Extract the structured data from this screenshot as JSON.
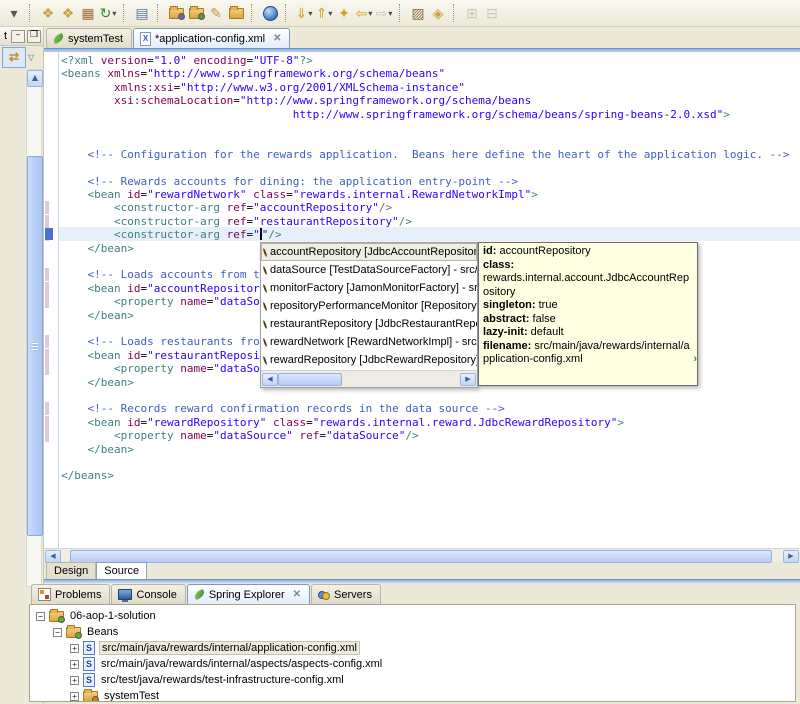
{
  "colors": {
    "accent_blue": "#6F94C4",
    "selection_line": "#E6F0FB",
    "tooltip_bg": "#FFFFE1",
    "tag": "#3F7F7F",
    "attr": "#7F0055",
    "value": "#2A00FF",
    "comment": "#3F5FBF"
  },
  "toolbar": {
    "groups": [
      [
        {
          "name": "toolbar-dropdown-icon",
          "glyph": "▾",
          "color": "#555555"
        }
      ],
      [
        {
          "name": "new-spring-project-icon",
          "glyph": "❖",
          "color": "#C8A23C"
        },
        {
          "name": "new-spring-project-alt-icon",
          "glyph": "❖",
          "color": "#C8A23C"
        },
        {
          "name": "new-java-package-icon",
          "glyph": "▦",
          "color": "#A5683B"
        },
        {
          "name": "refresh-icon",
          "glyph": "↻",
          "color": "#2E8B2E",
          "caret": true
        }
      ],
      [
        {
          "name": "new-file-icon",
          "glyph": "▤",
          "color": "#5B7AA6"
        }
      ],
      [
        {
          "name": "open-import-folder-icon",
          "glyph": "folder",
          "dot": "#7B5EA7"
        },
        {
          "name": "open-export-folder-icon",
          "glyph": "folder",
          "dot": "#4E9A4E"
        },
        {
          "name": "edit-pencil-icon",
          "glyph": "✎",
          "color": "#C89234"
        },
        {
          "name": "open-folder-icon",
          "glyph": "folder"
        }
      ],
      [
        {
          "name": "web-browser-icon",
          "glyph": "globe"
        }
      ],
      [
        {
          "name": "import-arrow-icon",
          "glyph": "⇓",
          "color": "#D8A019",
          "caret": true
        },
        {
          "name": "export-arrow-icon",
          "glyph": "⇑",
          "color": "#D8A019",
          "caret": true
        },
        {
          "name": "last-edit-location-icon",
          "glyph": "✦",
          "color": "#D8A019"
        },
        {
          "name": "back-icon",
          "glyph": "⇦",
          "color": "#D8A019",
          "caret": true
        },
        {
          "name": "forward-icon",
          "glyph": "⇨",
          "color": "#9C9884",
          "disabled": true,
          "caret": true
        }
      ],
      [
        {
          "name": "mark-occurrences-icon",
          "glyph": "▨",
          "color": "#8A6B3F"
        },
        {
          "name": "annotation-icon",
          "glyph": "◈",
          "color": "#C8A23C"
        }
      ],
      [
        {
          "name": "expand-all-icon",
          "glyph": "⊞",
          "color": "#9C9884",
          "disabled": true
        },
        {
          "name": "collapse-all-icon",
          "glyph": "⊟",
          "color": "#9C9884",
          "disabled": true
        }
      ]
    ]
  },
  "left_rail": {
    "header_label": "t"
  },
  "editor": {
    "tabs": [
      {
        "label": "systemTest",
        "icon": "leaf",
        "active": false
      },
      {
        "label": "*application-config.xml",
        "icon": "xmldoc",
        "active": true,
        "close": true
      }
    ],
    "current_line": 14,
    "change_bars": [
      12,
      13,
      14,
      17,
      18,
      19,
      22,
      23,
      24,
      27,
      28,
      29
    ],
    "lines": [
      [
        [
          "<?xml ",
          "tag"
        ],
        [
          "version",
          "attr"
        ],
        [
          "=",
          "plain"
        ],
        [
          "\"1.0\"",
          "val"
        ],
        [
          " ",
          "plain"
        ],
        [
          "encoding",
          "attr"
        ],
        [
          "=",
          "plain"
        ],
        [
          "\"UTF-8\"",
          "val"
        ],
        [
          "?>",
          "tag"
        ]
      ],
      [
        [
          "<beans ",
          "tag"
        ],
        [
          "xmlns",
          "attr"
        ],
        [
          "=",
          "plain"
        ],
        [
          "\"http://www.springframework.org/schema/beans\"",
          "val"
        ]
      ],
      [
        [
          "        ",
          "plain"
        ],
        [
          "xmlns:xsi",
          "attr"
        ],
        [
          "=",
          "plain"
        ],
        [
          "\"http://www.w3.org/2001/XMLSchema-instance\"",
          "val"
        ]
      ],
      [
        [
          "        ",
          "plain"
        ],
        [
          "xsi:schemaLocation",
          "attr"
        ],
        [
          "=",
          "plain"
        ],
        [
          "\"http://www.springframework.org/schema/beans",
          "val"
        ]
      ],
      [
        [
          "                                   ",
          "plain"
        ],
        [
          "http://www.springframework.org/schema/beans/spring-beans-2.0.xsd\"",
          "val"
        ],
        [
          ">",
          "tag"
        ]
      ],
      [],
      [],
      [
        [
          "    ",
          "plain"
        ],
        [
          "<!-- Configuration for the rewards application.  Beans here define the heart of the application logic. -->",
          "comment"
        ]
      ],
      [],
      [
        [
          "    ",
          "plain"
        ],
        [
          "<!-- Rewards accounts for dining: the application entry-point -->",
          "comment"
        ]
      ],
      [
        [
          "    ",
          "plain"
        ],
        [
          "<bean ",
          "tag"
        ],
        [
          "id",
          "attr"
        ],
        [
          "=",
          "plain"
        ],
        [
          "\"rewardNetwork\"",
          "val"
        ],
        [
          " ",
          "plain"
        ],
        [
          "class",
          "attr"
        ],
        [
          "=",
          "plain"
        ],
        [
          "\"rewards.internal.RewardNetworkImpl\"",
          "val"
        ],
        [
          ">",
          "tag"
        ]
      ],
      [
        [
          "        ",
          "plain"
        ],
        [
          "<constructor-arg ",
          "tag"
        ],
        [
          "ref",
          "attr"
        ],
        [
          "=",
          "plain"
        ],
        [
          "\"accountRepository\"",
          "val"
        ],
        [
          "/>",
          "tag"
        ]
      ],
      [
        [
          "        ",
          "plain"
        ],
        [
          "<constructor-arg ",
          "tag"
        ],
        [
          "ref",
          "attr"
        ],
        [
          "=",
          "plain"
        ],
        [
          "\"restaurantRepository\"",
          "val"
        ],
        [
          "/>",
          "tag"
        ]
      ],
      [
        [
          "        ",
          "plain"
        ],
        [
          "<constructor-arg ",
          "tag"
        ],
        [
          "ref",
          "attr"
        ],
        [
          "=",
          "plain"
        ],
        [
          "\"",
          "val"
        ],
        [
          "",
          "caret"
        ],
        [
          "\"",
          "val"
        ],
        [
          "/>",
          "tag"
        ]
      ],
      [
        [
          "    ",
          "plain"
        ],
        [
          "</bean>",
          "tag"
        ]
      ],
      [],
      [
        [
          "    ",
          "plain"
        ],
        [
          "<!-- Loads accounts from t",
          "comment"
        ]
      ],
      [
        [
          "    ",
          "plain"
        ],
        [
          "<bean ",
          "tag"
        ],
        [
          "id",
          "attr"
        ],
        [
          "=",
          "plain"
        ],
        [
          "\"accountRepositor",
          "val"
        ]
      ],
      [
        [
          "        ",
          "plain"
        ],
        [
          "<property ",
          "tag"
        ],
        [
          "name",
          "attr"
        ],
        [
          "=",
          "plain"
        ],
        [
          "\"dataSo",
          "val"
        ]
      ],
      [
        [
          "    ",
          "plain"
        ],
        [
          "</bean>",
          "tag"
        ]
      ],
      [],
      [
        [
          "    ",
          "plain"
        ],
        [
          "<!-- Loads restaurants fro",
          "comment"
        ]
      ],
      [
        [
          "    ",
          "plain"
        ],
        [
          "<bean ",
          "tag"
        ],
        [
          "id",
          "attr"
        ],
        [
          "=",
          "plain"
        ],
        [
          "\"restaurantReposi",
          "val"
        ]
      ],
      [
        [
          "        ",
          "plain"
        ],
        [
          "<property ",
          "tag"
        ],
        [
          "name",
          "attr"
        ],
        [
          "=",
          "plain"
        ],
        [
          "\"dataSo",
          "val"
        ]
      ],
      [
        [
          "    ",
          "plain"
        ],
        [
          "</bean>",
          "tag"
        ]
      ],
      [],
      [
        [
          "    ",
          "plain"
        ],
        [
          "<!-- Records reward confirmation records in the data source -->",
          "comment"
        ]
      ],
      [
        [
          "    ",
          "plain"
        ],
        [
          "<bean ",
          "tag"
        ],
        [
          "id",
          "attr"
        ],
        [
          "=",
          "plain"
        ],
        [
          "\"rewardRepository\"",
          "val"
        ],
        [
          " ",
          "plain"
        ],
        [
          "class",
          "attr"
        ],
        [
          "=",
          "plain"
        ],
        [
          "\"rewards.internal.reward.JdbcRewardRepository\"",
          "val"
        ],
        [
          ">",
          "tag"
        ]
      ],
      [
        [
          "        ",
          "plain"
        ],
        [
          "<property ",
          "tag"
        ],
        [
          "name",
          "attr"
        ],
        [
          "=",
          "plain"
        ],
        [
          "\"dataSource\"",
          "val"
        ],
        [
          " ",
          "plain"
        ],
        [
          "ref",
          "attr"
        ],
        [
          "=",
          "plain"
        ],
        [
          "\"dataSource\"",
          "val"
        ],
        [
          "/>",
          "tag"
        ]
      ],
      [
        [
          "    ",
          "plain"
        ],
        [
          "</bean>",
          "tag"
        ]
      ],
      [],
      [
        [
          "</beans>",
          "tag"
        ]
      ]
    ]
  },
  "completion_popup": {
    "items": [
      {
        "label": "accountRepository [JdbcAccountRepository] - src/main/ja",
        "selected": true
      },
      {
        "label": "dataSource [TestDataSourceFactory] - src/test/java"
      },
      {
        "label": "monitorFactory [JamonMonitorFactory] - src/main/java"
      },
      {
        "label": "repositoryPerformanceMonitor [RepositoryPerformanceMonitor]"
      },
      {
        "label": "restaurantRepository [JdbcRestaurantRepository] - src"
      },
      {
        "label": "rewardNetwork [RewardNetworkImpl] - src/main/java"
      },
      {
        "label": "rewardRepository [JdbcRewardRepository] - src/main"
      }
    ]
  },
  "bean_tooltip": {
    "fields": [
      {
        "label": "id:",
        "value": "accountRepository"
      },
      {
        "label": "class:",
        "value": "rewards.internal.account.JdbcAccountRepository",
        "block": true
      },
      {
        "label": "singleton:",
        "value": "true"
      },
      {
        "label": "abstract:",
        "value": "false"
      },
      {
        "label": "lazy-init:",
        "value": "default"
      },
      {
        "label": "filename:",
        "value": "src/main/java/rewards/internal/application-config.xml"
      }
    ],
    "continuation_arrow": "›"
  },
  "page_tabs": [
    {
      "label": "Design",
      "active": false
    },
    {
      "label": "Source",
      "active": true
    }
  ],
  "bottom_panel": {
    "tabs": [
      {
        "label": "Problems",
        "icon": "problems"
      },
      {
        "label": "Console",
        "icon": "console"
      },
      {
        "label": "Spring Explorer",
        "icon": "leaf",
        "active": true,
        "close": true
      },
      {
        "label": "Servers",
        "icon": "servers"
      }
    ],
    "tree": [
      {
        "depth": 0,
        "exp": "minus",
        "icon": "project",
        "label": "06-aop-1-solution"
      },
      {
        "depth": 1,
        "exp": "minus",
        "icon": "beans",
        "label": "Beans"
      },
      {
        "depth": 2,
        "exp": "plus",
        "icon": "beanconfig",
        "label": "src/main/java/rewards/internal/application-config.xml",
        "selected": true
      },
      {
        "depth": 2,
        "exp": "plus",
        "icon": "beanconfig",
        "label": "src/main/java/rewards/internal/aspects/aspects-config.xml"
      },
      {
        "depth": 2,
        "exp": "plus",
        "icon": "beanconfig",
        "label": "src/test/java/rewards/test-infrastructure-config.xml"
      },
      {
        "depth": 2,
        "exp": "plus",
        "icon": "configset",
        "label": "systemTest"
      }
    ]
  },
  "icons": {
    "xml_file_letter": "X",
    "bean_config_letter": "S"
  }
}
